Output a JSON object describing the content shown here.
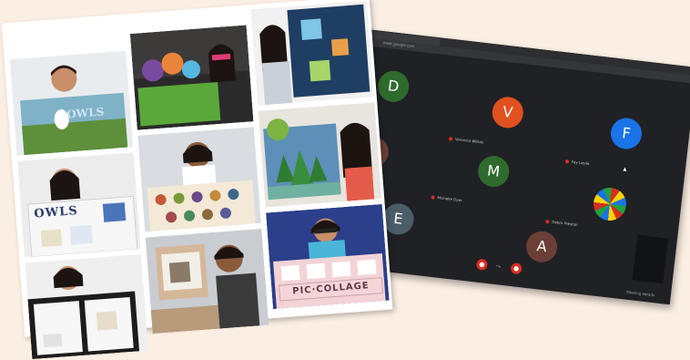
{
  "collage": {
    "owls_label_a": "OWLS",
    "owls_label_b": "OWLS",
    "pic_collage_label": "PIC·COLLAGE"
  },
  "meeting": {
    "url": "meet.google.com",
    "participants": [
      {
        "initial": "D",
        "color": "#2f6b2d"
      },
      {
        "initial": "V",
        "color": "#e0511f"
      },
      {
        "initial": "F",
        "color": "#1a73e8"
      },
      {
        "initial": "R",
        "color": "#6b3f36"
      },
      {
        "initial": "M",
        "color": "#2f6b2d"
      },
      {
        "initial": "E",
        "color": "#4a5d68"
      },
      {
        "initial": "A",
        "color": "#6b3f36"
      }
    ],
    "names": [
      "Veronica Wilson",
      "Fay Leslie",
      "Michelle Dyer",
      "Debra Preston"
    ],
    "controls": {
      "mic": "●",
      "end": "⤳",
      "cam": "●"
    },
    "details_label": "Meeting details"
  },
  "colors": {
    "background": "#fbeee2",
    "meeting_bg": "#202124"
  }
}
